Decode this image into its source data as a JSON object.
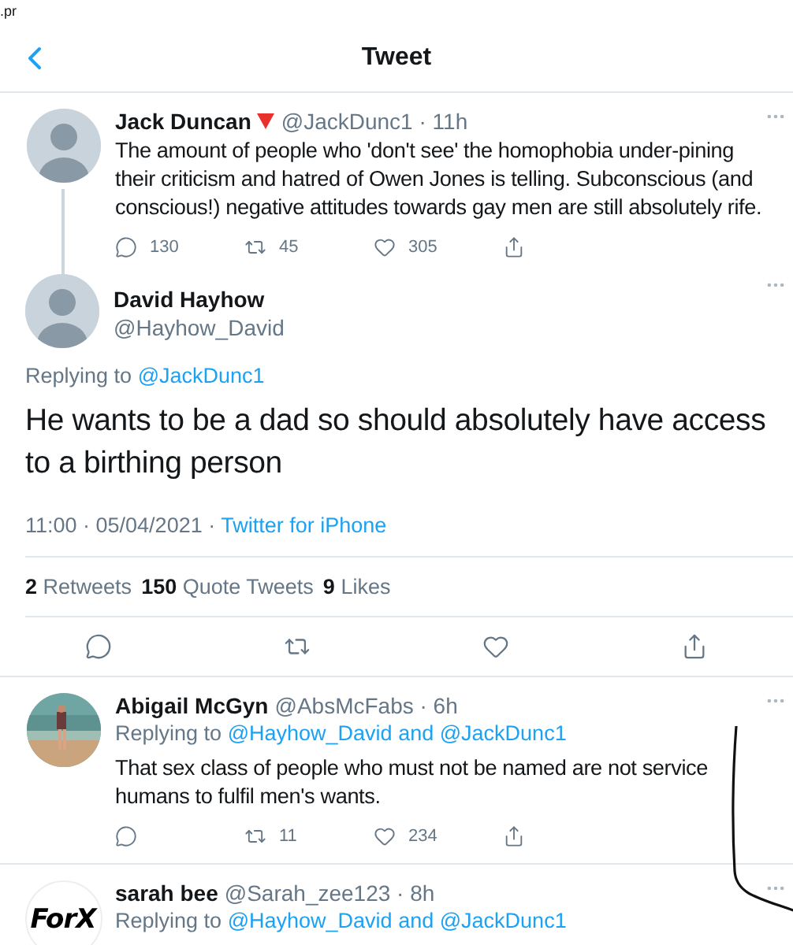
{
  "status_text": ".pr",
  "header": {
    "title": "Tweet"
  },
  "parent_tweet": {
    "name": "Jack Duncan",
    "name_badge": {
      "kind": "red_triangle"
    },
    "handle": "@JackDunc1 · 11h",
    "text": "The amount of people who 'don't see' the homophobia under-pining their criticism and hatred of Owen Jones is telling. Subconscious (and conscious!) negative attitudes towards gay men are still absolutely rife.",
    "actions": [
      {
        "kind": "reply",
        "count": "130"
      },
      {
        "kind": "retweet",
        "count": "45"
      },
      {
        "kind": "like",
        "count": "305"
      },
      {
        "kind": "share"
      }
    ]
  },
  "main_tweet": {
    "name": "David Hayhow",
    "handle": "@Hayhow_David",
    "replying_label": "Replying to",
    "replying_to": "@JackDunc1",
    "text": "He wants to be a dad so should absolutely have access to a birthing person",
    "timestamp": "11:00 · 05/04/2021 ·",
    "source": "Twitter for iPhone",
    "stats": [
      {
        "count": "2",
        "label": "Retweets"
      },
      {
        "count": "150",
        "label": "Quote Tweets"
      },
      {
        "count": "9",
        "label": "Likes"
      }
    ],
    "actions": [
      {
        "kind": "reply"
      },
      {
        "kind": "retweet"
      },
      {
        "kind": "like"
      },
      {
        "kind": "share"
      }
    ]
  },
  "replies": [
    {
      "name": "Abigail McGyn",
      "handle": "@AbsMcFabs · 6h",
      "replying_label": "Replying to",
      "replying_to": "@Hayhow_David and @JackDunc1",
      "text": "That sex class of people who must not be named are not service humans to fulfil men's wants.",
      "actions": [
        {
          "kind": "reply"
        },
        {
          "kind": "retweet",
          "count": "11"
        },
        {
          "kind": "like",
          "count": "234"
        },
        {
          "kind": "share"
        }
      ]
    },
    {
      "name": "sarah bee",
      "handle": "@Sarah_zee123 · 8h",
      "avatar": {
        "kind": "logo",
        "text": "ForX"
      },
      "replying_label": "Replying to",
      "replying_to": "@Hayhow_David and @JackDunc1"
    }
  ],
  "ink_stroke": true
}
